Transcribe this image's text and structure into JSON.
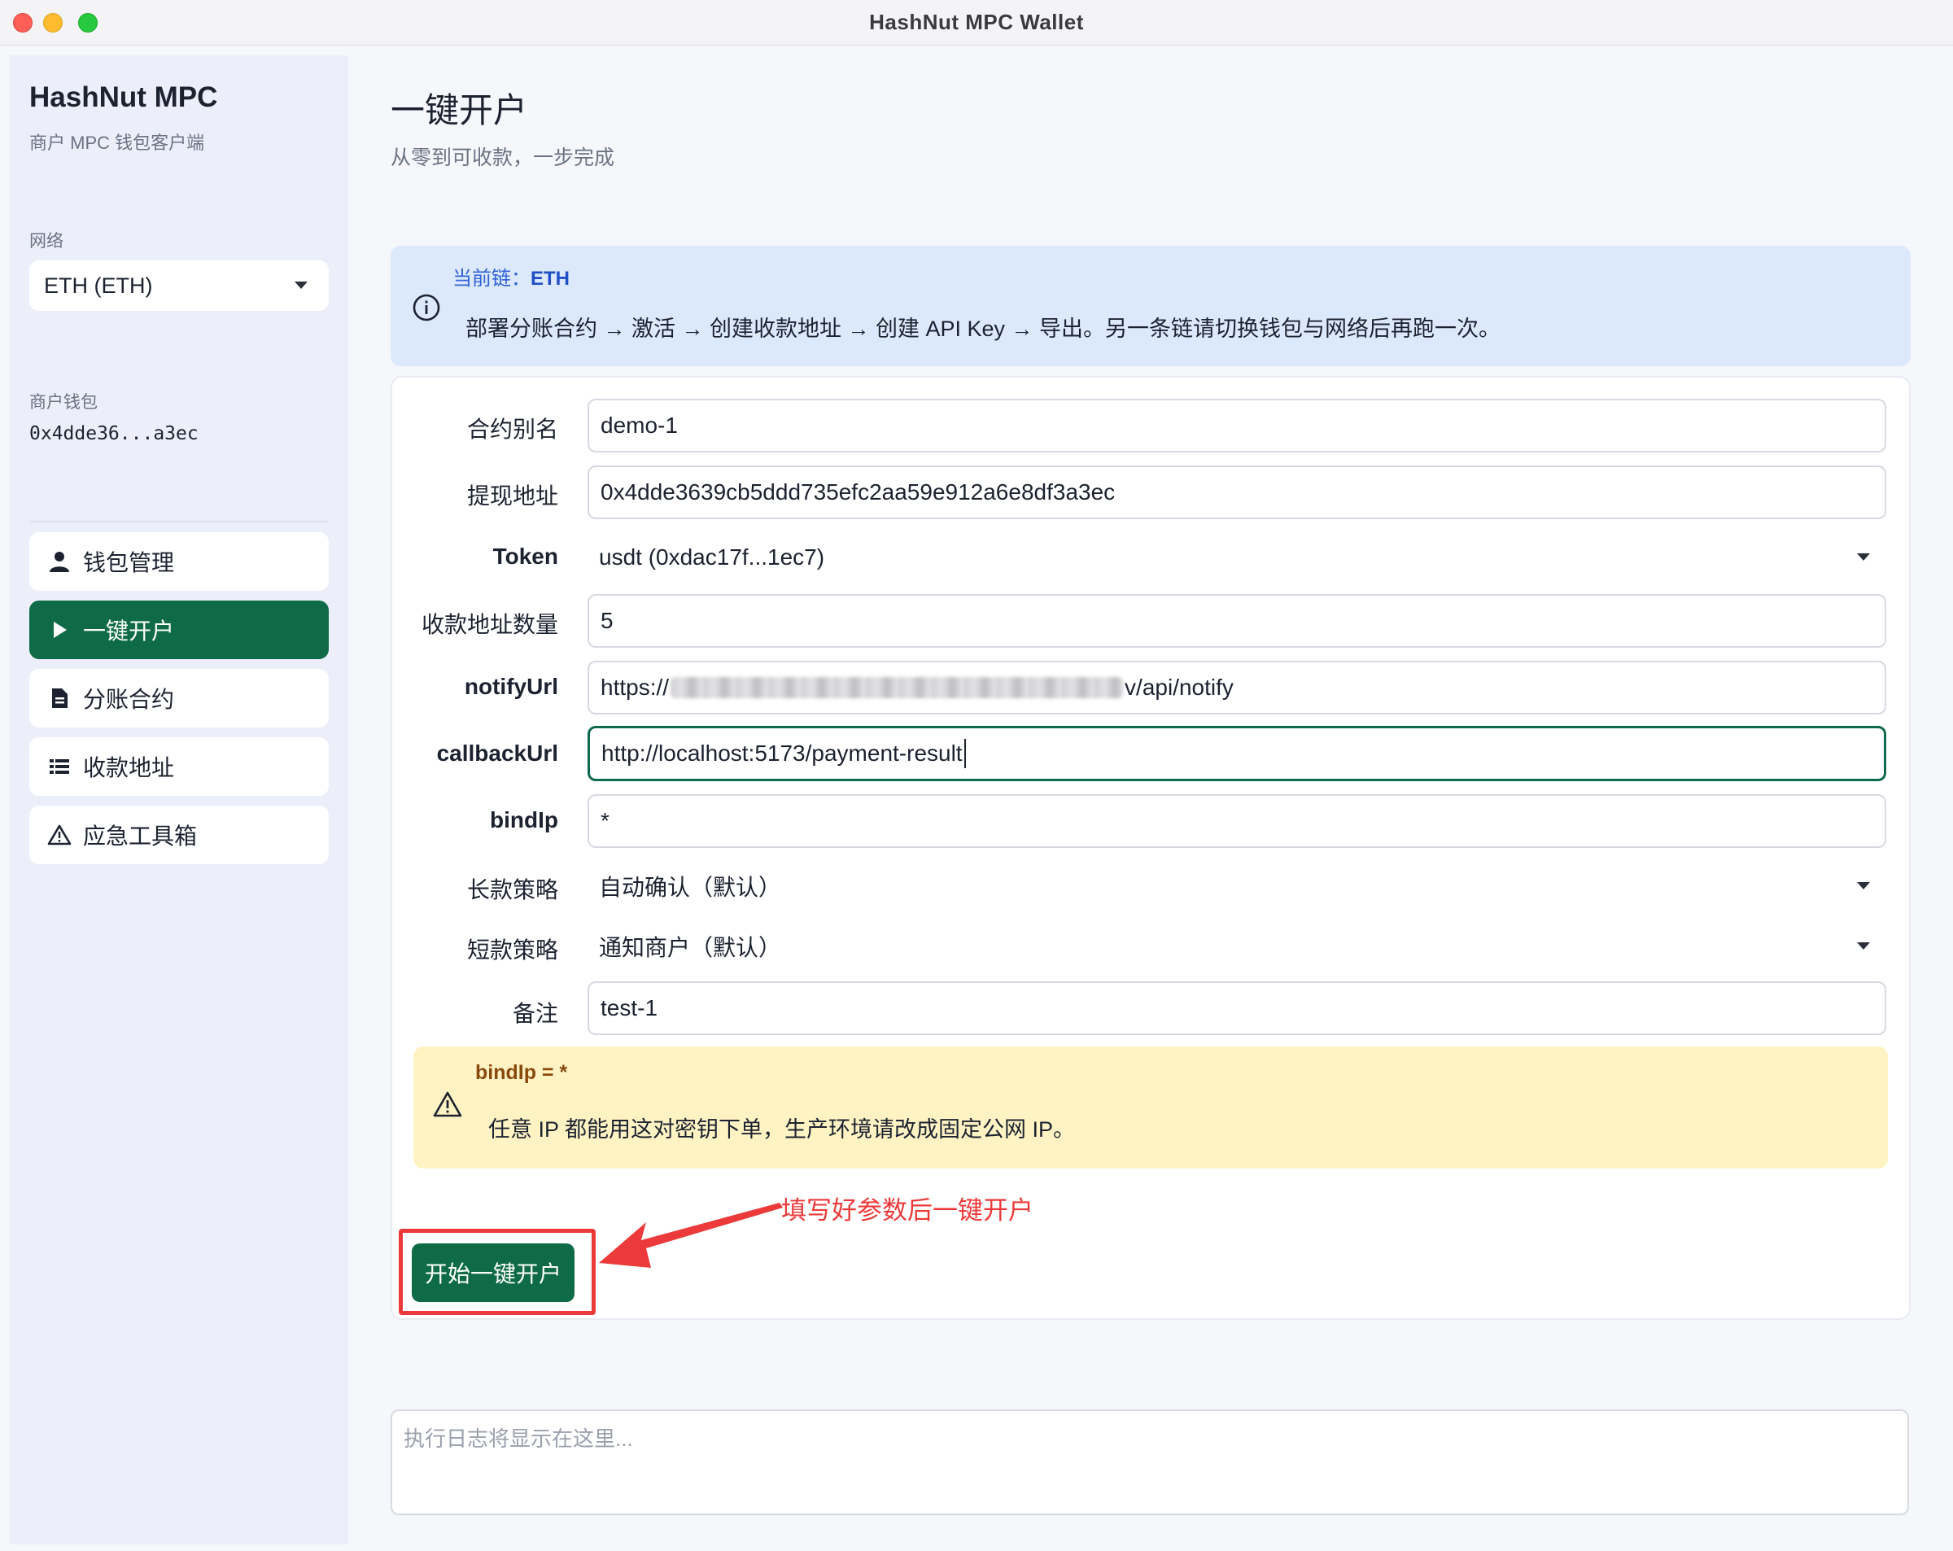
{
  "window": {
    "title": "HashNut MPC Wallet"
  },
  "sidebar": {
    "brand": "HashNut MPC",
    "brand_sub": "商户 MPC 钱包客户端",
    "network_label": "网络",
    "network_value": "ETH (ETH)",
    "wallet_label": "商户钱包",
    "wallet_address": "0x4dde36...a3ec",
    "items": [
      {
        "label": "钱包管理",
        "icon": "user-icon",
        "active": false
      },
      {
        "label": "一键开户",
        "icon": "play-icon",
        "active": true
      },
      {
        "label": "分账合约",
        "icon": "document-icon",
        "active": false
      },
      {
        "label": "收款地址",
        "icon": "list-icon",
        "active": false
      },
      {
        "label": "应急工具箱",
        "icon": "warning-icon",
        "active": false
      }
    ]
  },
  "main": {
    "title": "一键开户",
    "subtitle": "从零到可收款，一步完成",
    "info": {
      "head_prefix": "当前链：",
      "head_chain": "ETH",
      "text": "部署分账合约 → 激活 → 创建收款地址 → 创建 API Key → 导出。另一条链请切换钱包与网络后再跑一次。"
    },
    "form": {
      "alias_label": "合约别名",
      "alias_value": "demo-1",
      "withdraw_label": "提现地址",
      "withdraw_value": "0x4dde3639cb5ddd735efc2aa59e912a6e8df3a3ec",
      "token_label": "Token",
      "token_value": "usdt (0xdac17f...1ec7)",
      "count_label": "收款地址数量",
      "count_value": "5",
      "notify_label": "notifyUrl",
      "notify_prefix": "https://",
      "notify_suffix": "v/api/notify",
      "callback_label": "callbackUrl",
      "callback_value": "http://localhost:5173/payment-result",
      "bindip_label": "bindIp",
      "bindip_value": "*",
      "long_label": "长款策略",
      "long_value": "自动确认（默认）",
      "short_label": "短款策略",
      "short_value": "通知商户（默认）",
      "remark_label": "备注",
      "remark_value": "test-1"
    },
    "warning": {
      "head": "bindIp = *",
      "text": "任意 IP 都能用这对密钥下单，生产环境请改成固定公网 IP。"
    },
    "start_button": "开始一键开户",
    "annotation": "填写好参数后一键开户",
    "log_placeholder": "执行日志将显示在这里..."
  },
  "colors": {
    "accent": "#0f6b47",
    "info_bg": "#dce9fd",
    "warning_bg": "#fff3c4",
    "annotation": "#ec3a3a"
  }
}
